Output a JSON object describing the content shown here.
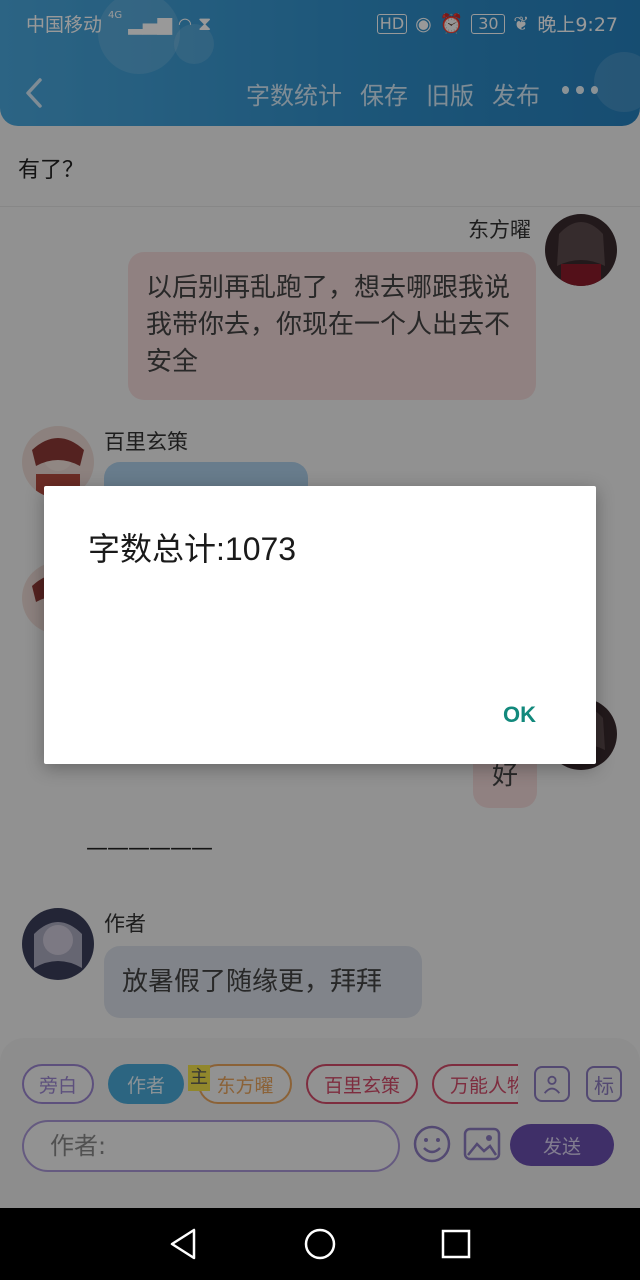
{
  "status_bar": {
    "carrier": "中国移动",
    "network": "4G",
    "hd_label": "HD",
    "battery": "30",
    "time": "晚上9:27"
  },
  "toolbar": {
    "items": [
      "字数统计",
      "保存",
      "旧版",
      "发布"
    ]
  },
  "chat": {
    "top_line": "有了？",
    "messages": [
      {
        "sender": "东方曜",
        "side": "right",
        "text": "以后别再乱跑了，想去哪跟我说我带你去，你现在一个人出去不安全",
        "bubble_color": "#f1d7d8"
      },
      {
        "sender": "百里玄策",
        "side": "left",
        "text": "",
        "bubble_color": "#aecfe9"
      },
      {
        "sender": "",
        "side": "right",
        "text": "好",
        "bubble_color": "#f1d7d8"
      },
      {
        "sender": "作者",
        "side": "left",
        "text": "放暑假了随缘更，拜拜",
        "bubble_color": "#d7dde6"
      }
    ],
    "divider_text": "——————"
  },
  "input_panel": {
    "roles": [
      {
        "label": "旁白",
        "color": "#9b86d1",
        "selected": false
      },
      {
        "label": "作者",
        "color": "#4aa9d8",
        "selected": true
      },
      {
        "label": "东方曜",
        "color": "#e8a35c",
        "selected": false
      },
      {
        "label": "百里玄策",
        "color": "#d24b6a",
        "selected": false
      },
      {
        "label": "万能人物",
        "color": "#d24b6a",
        "selected": false
      }
    ],
    "main_tag": "主",
    "side_icon_label": "标",
    "input_value": "作者:",
    "send_label": "发送"
  },
  "dialog": {
    "message": "字数总计:1073",
    "ok_label": "OK"
  },
  "colors": {
    "header": "#2f8ec9",
    "accent_ok": "#12897c",
    "send": "#6a4fae"
  }
}
